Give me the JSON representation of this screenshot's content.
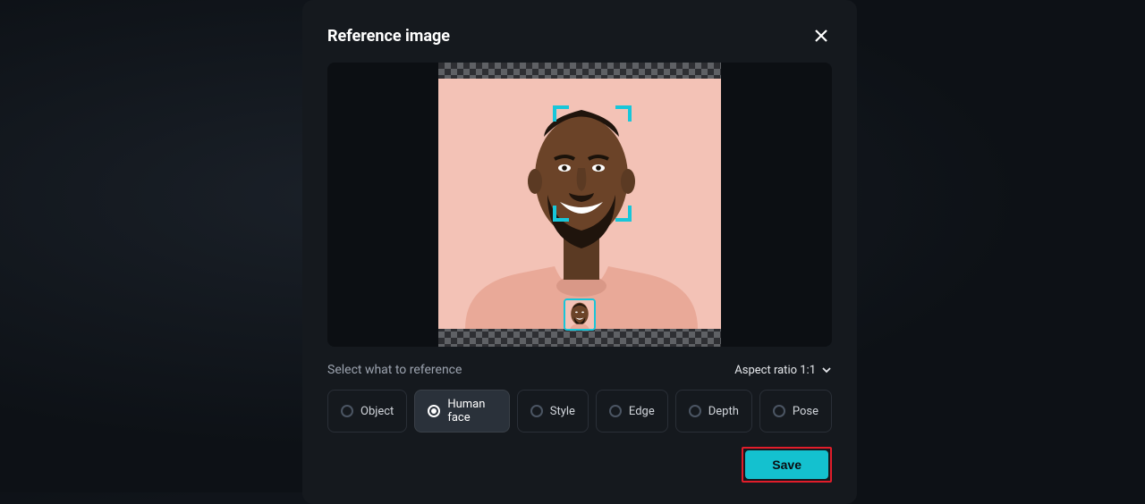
{
  "modal": {
    "title": "Reference image",
    "select_label": "Select what to reference",
    "aspect_label": "Aspect ratio 1:1",
    "options": {
      "object": "Object",
      "human_face": "Human face",
      "style": "Style",
      "edge": "Edge",
      "depth": "Depth",
      "pose": "Pose"
    },
    "selected_option": "human_face",
    "save_label": "Save"
  }
}
